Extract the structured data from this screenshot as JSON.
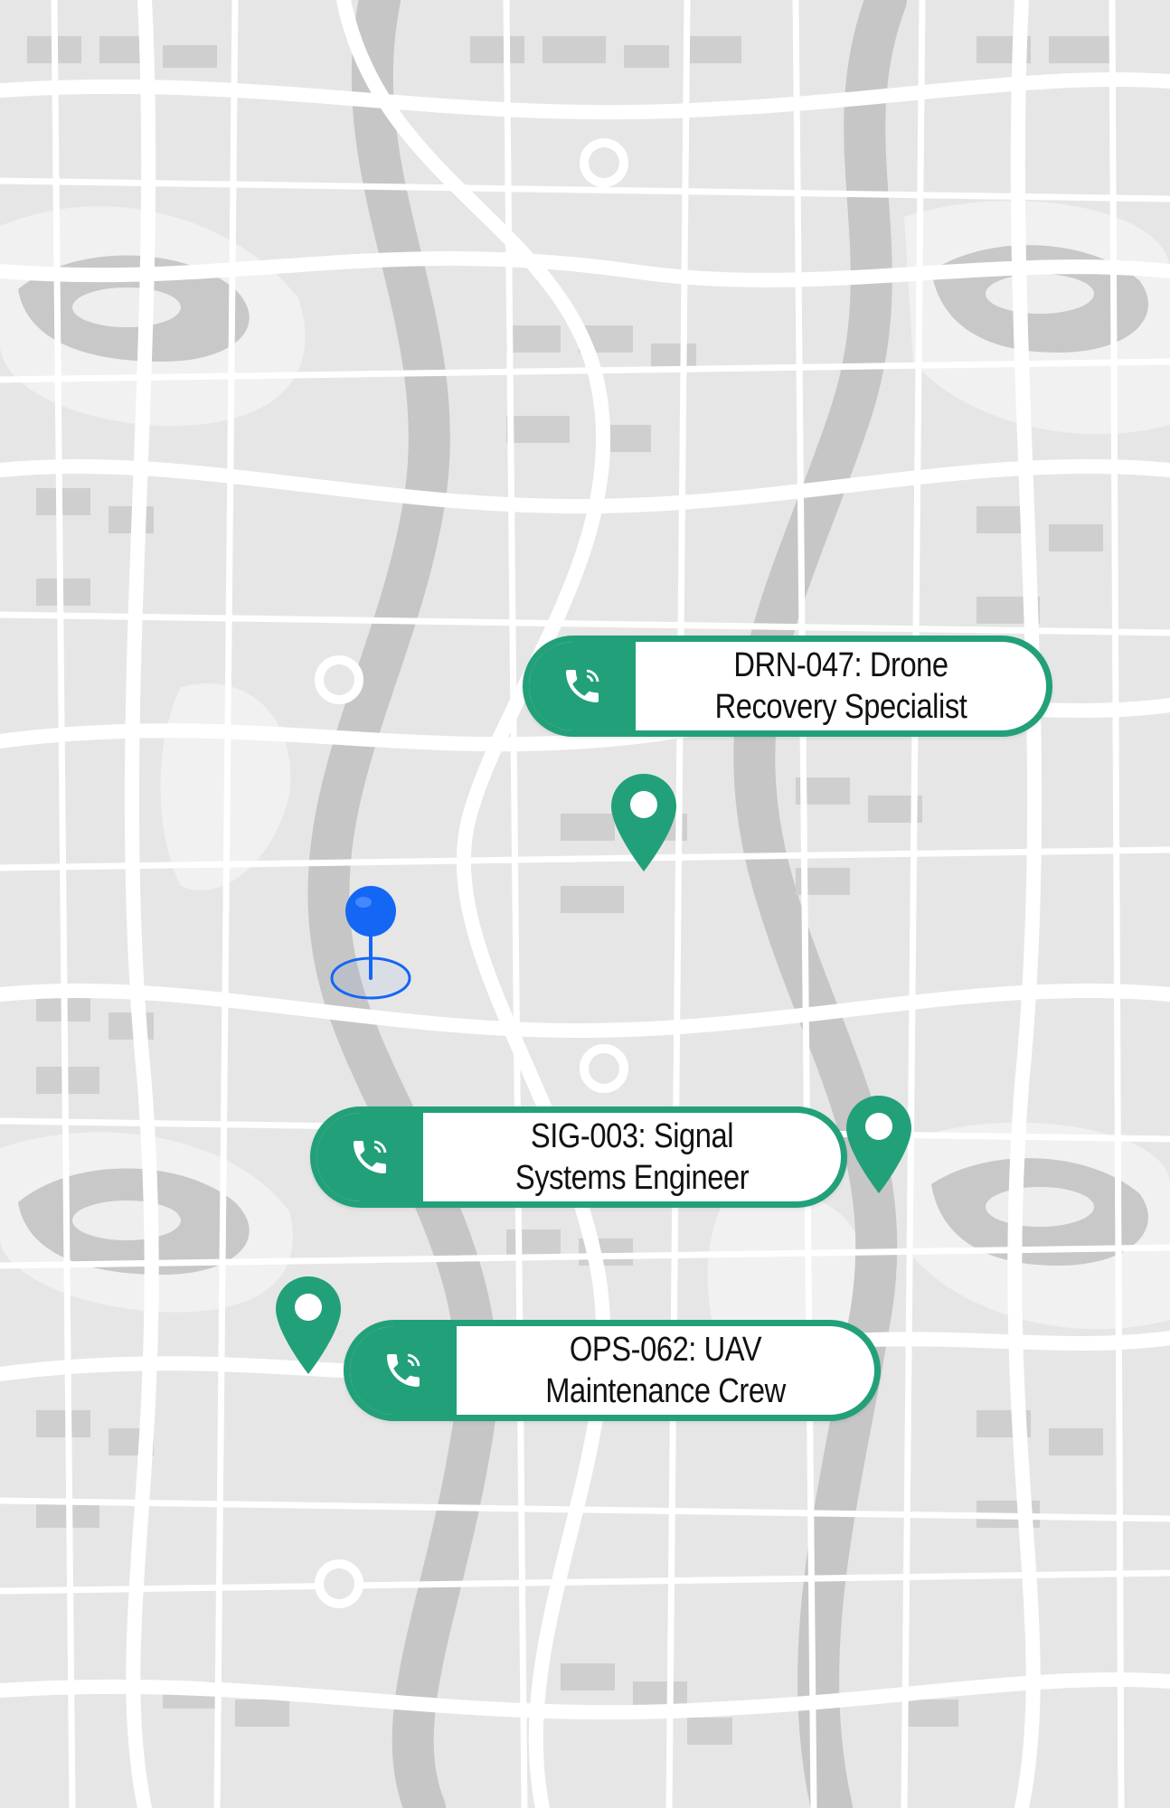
{
  "colors": {
    "map_background": "#e6e6e6",
    "map_road": "#ffffff",
    "map_block": "#c9c9c9",
    "map_river": "#bdbdbd",
    "map_park": "#f0f0f0",
    "accent_green": "#22a07a",
    "location_blue": "#1466f5"
  },
  "icons": {
    "call": "phone-icon",
    "pin": "map-pin-icon",
    "current_location": "location-pushpin-icon"
  },
  "contacts": [
    {
      "id": "drn-047",
      "label_line1": "DRN-047: Drone",
      "label_line2": "Recovery Specialist"
    },
    {
      "id": "sig-003",
      "label_line1": "SIG-003: Signal",
      "label_line2": "Systems Engineer"
    },
    {
      "id": "ops-062",
      "label_line1": "OPS-062: UAV",
      "label_line2": "Maintenance Crew"
    }
  ]
}
